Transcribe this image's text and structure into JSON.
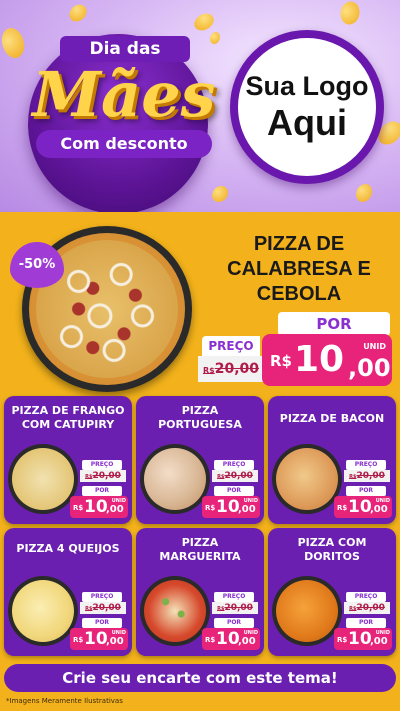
{
  "header": {
    "title_top": "Dia das",
    "title_main": "Mães",
    "title_bottom": "Com desconto",
    "logo_line1": "Sua Logo",
    "logo_line2": "Aqui"
  },
  "featured": {
    "discount": "-50%",
    "name": "PIZZA DE CALABRESA E CEBOLA",
    "preco_label": "PREÇO",
    "old_currency": "R$",
    "old_price": "20,00",
    "por_label": "POR",
    "currency": "R$",
    "price_int": "10",
    "price_cents": ",00",
    "unit": "UNID"
  },
  "products": [
    {
      "name": "PIZZA DE FRANGO COM CATUPIRY",
      "preco_label": "PREÇO",
      "old_currency": "R$",
      "old_price": "20,00",
      "por_label": "POR",
      "currency": "R$",
      "price_int": "10",
      "price_cents": ",00",
      "unit": "UNID"
    },
    {
      "name": "PIZZA PORTUGUESA",
      "preco_label": "PREÇO",
      "old_currency": "R$",
      "old_price": "20,00",
      "por_label": "POR",
      "currency": "R$",
      "price_int": "10",
      "price_cents": ",00",
      "unit": "UNID"
    },
    {
      "name": "PIZZA DE BACON",
      "preco_label": "PREÇO",
      "old_currency": "R$",
      "old_price": "20,00",
      "por_label": "POR",
      "currency": "R$",
      "price_int": "10",
      "price_cents": ",00",
      "unit": "UNID"
    },
    {
      "name": "PIZZA 4 QUEIJOS",
      "preco_label": "PREÇO",
      "old_currency": "R$",
      "old_price": "20,00",
      "por_label": "POR",
      "currency": "R$",
      "price_int": "10",
      "price_cents": ",00",
      "unit": "UNID"
    },
    {
      "name": "PIZZA MARGUERITA",
      "preco_label": "PREÇO",
      "old_currency": "R$",
      "old_price": "20,00",
      "por_label": "POR",
      "currency": "R$",
      "price_int": "10",
      "price_cents": ",00",
      "unit": "UNID"
    },
    {
      "name": "PIZZA COM DORITOS",
      "preco_label": "PREÇO",
      "old_currency": "R$",
      "old_price": "20,00",
      "por_label": "POR",
      "currency": "R$",
      "price_int": "10",
      "price_cents": ",00",
      "unit": "UNID"
    }
  ],
  "cta": "Crie seu encarte com este tema!",
  "disclaimer": "*Imagens Meramente Ilustrativas",
  "colors": {
    "purple": "#6b1fb0",
    "pink": "#e8237a",
    "yellow": "#f3b21b"
  }
}
